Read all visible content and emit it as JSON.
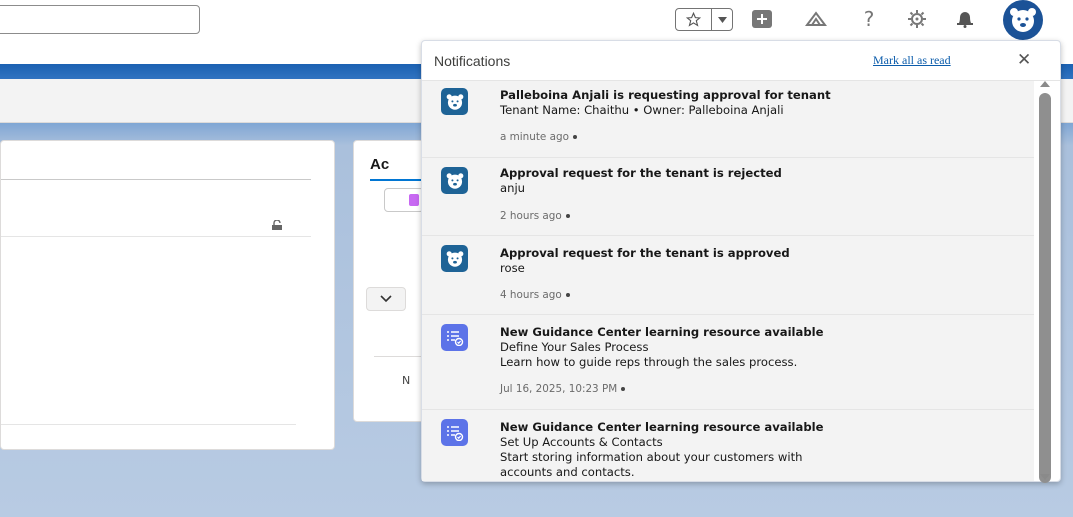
{
  "header": {
    "search_placeholder": "",
    "icons": [
      "star-icon",
      "chevron-down-icon",
      "plus-icon",
      "trailhead-icon",
      "help-icon",
      "gear-icon",
      "bell-icon",
      "avatar-icon"
    ]
  },
  "background": {
    "activity_tab": "Ac",
    "n_letter": "N"
  },
  "notifications": {
    "title": "Notifications",
    "mark_all_read": "Mark all as read",
    "close": "✕",
    "items": [
      {
        "icon": "bear-icon",
        "title": "Palleboina Anjali is requesting approval for tenant",
        "lines": [
          "Tenant Name: Chaithu • Owner: Palleboina Anjali"
        ],
        "time": "a minute ago"
      },
      {
        "icon": "bear-icon",
        "title": "Approval request for the tenant is rejected",
        "lines": [
          "anju"
        ],
        "time": "2 hours ago"
      },
      {
        "icon": "bear-icon",
        "title": "Approval request for the tenant is approved",
        "lines": [
          "rose"
        ],
        "time": "4 hours ago"
      },
      {
        "icon": "guidance-icon",
        "title": "New Guidance Center learning resource available",
        "lines": [
          "Define Your Sales Process",
          "Learn how to guide reps through the sales process."
        ],
        "time": "Jul 16, 2025, 10:23 PM"
      },
      {
        "icon": "guidance-icon",
        "title": "New Guidance Center learning resource available",
        "lines": [
          "Set Up Accounts & Contacts",
          "Start storing information about your customers with",
          "accounts and contacts."
        ],
        "time": ""
      }
    ]
  },
  "colors": {
    "brand_blue": "#1b5297",
    "link_blue": "#0b5cab",
    "guidance_purple": "#5c73e8"
  }
}
